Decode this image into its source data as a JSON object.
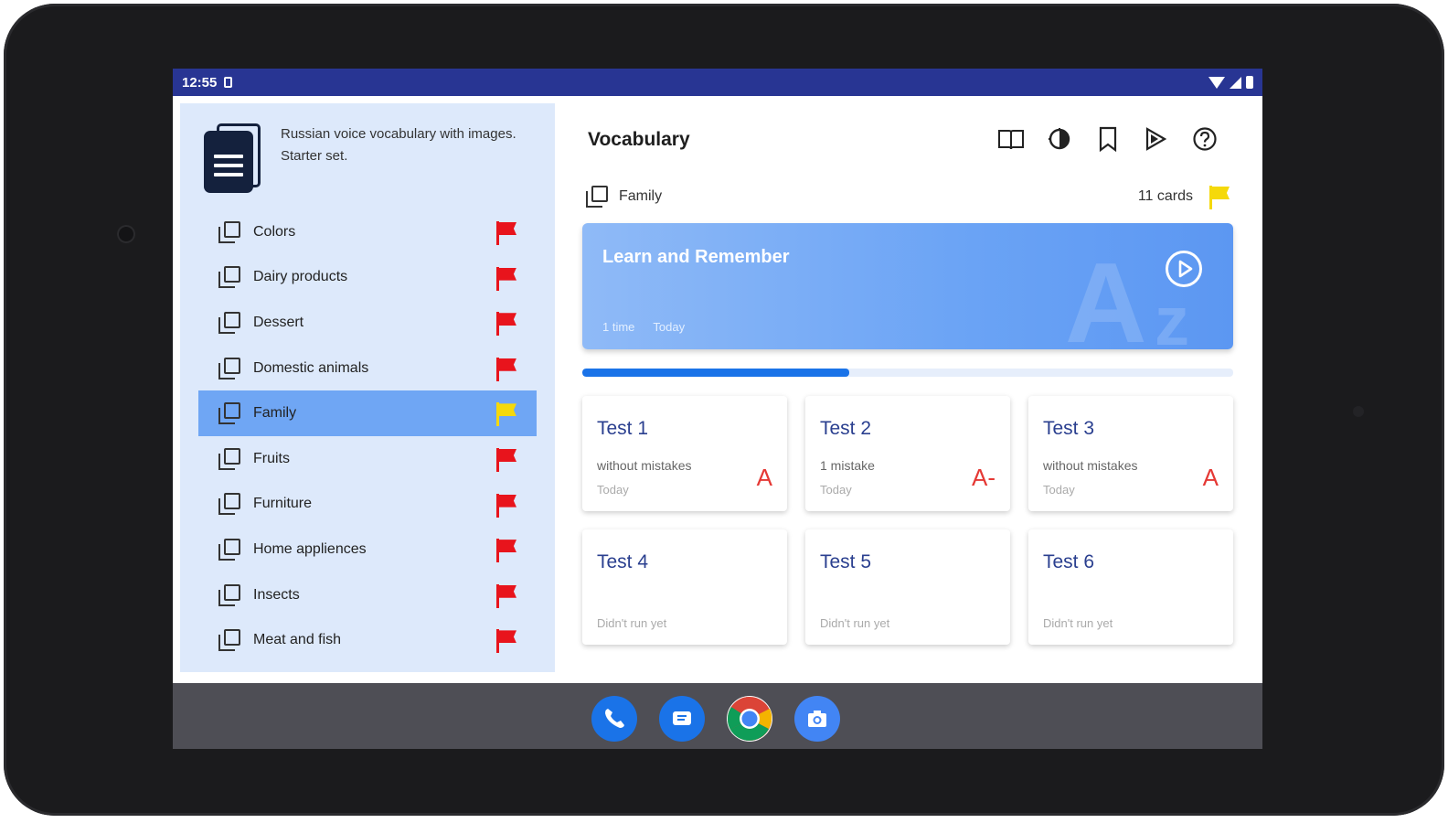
{
  "status_bar": {
    "time": "12:55",
    "sim_icon": "sim-card-icon",
    "wifi_icon": "wifi-icon",
    "signal_icon": "cell-signal-icon",
    "battery_icon": "battery-icon",
    "background_color": "#283593"
  },
  "sidebar": {
    "title": "Russian voice vocabulary with images. Starter set.",
    "icon": "document-stack-icon",
    "background_color": "#dde9fb",
    "selected_color": "#6fa6f4",
    "items": [
      {
        "label": "Colors",
        "flag": "red"
      },
      {
        "label": "Dairy products",
        "flag": "red"
      },
      {
        "label": "Dessert",
        "flag": "red"
      },
      {
        "label": "Domestic animals",
        "flag": "red"
      },
      {
        "label": "Family",
        "flag": "yellow",
        "selected": true
      },
      {
        "label": "Fruits",
        "flag": "red"
      },
      {
        "label": "Furniture",
        "flag": "red"
      },
      {
        "label": "Home appliences",
        "flag": "red"
      },
      {
        "label": "Insects",
        "flag": "red"
      },
      {
        "label": "Meat and fish",
        "flag": "red"
      }
    ]
  },
  "header": {
    "title": "Vocabulary",
    "toolbar": [
      "book-icon",
      "contrast-icon",
      "bookmark-icon",
      "play-all-icon",
      "help-icon"
    ]
  },
  "deck": {
    "name": "Family",
    "count": "11 cards",
    "flag_color": "#f5d90a"
  },
  "learn": {
    "title": "Learn and Remember",
    "times": "1 time",
    "date": "Today",
    "watermark": "Az",
    "progress": 0.41
  },
  "tests": [
    {
      "title": "Test 1",
      "result": "without mistakes",
      "date": "Today",
      "grade": "A"
    },
    {
      "title": "Test 2",
      "result": "1 mistake",
      "date": "Today",
      "grade": "A-"
    },
    {
      "title": "Test 3",
      "result": "without mistakes",
      "date": "Today",
      "grade": "A"
    },
    {
      "title": "Test 4",
      "result": "",
      "date": "Didn't run yet",
      "grade": ""
    },
    {
      "title": "Test 5",
      "result": "",
      "date": "Didn't run yet",
      "grade": ""
    },
    {
      "title": "Test 6",
      "result": "",
      "date": "Didn't run yet",
      "grade": ""
    }
  ],
  "dock": [
    "phone-icon",
    "messages-icon",
    "chrome-icon",
    "camera-icon"
  ],
  "colors": {
    "accent": "#1a73e8",
    "flag_red": "#e8141c",
    "flag_yellow": "#f5d90a",
    "grade_red": "#e53935",
    "test_title": "#2a3f8f"
  }
}
